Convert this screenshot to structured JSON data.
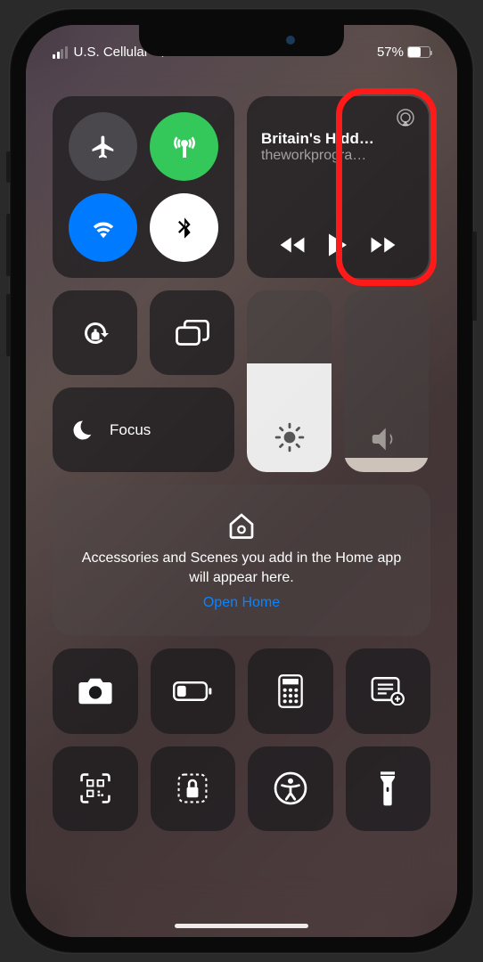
{
  "status": {
    "carrier": "U.S. Cellular",
    "battery_pct": "57%"
  },
  "media": {
    "title": "Britain's Hidd…",
    "subtitle": "theworkprogra…"
  },
  "focus": {
    "label": "Focus"
  },
  "brightness": {
    "level_pct": 60
  },
  "volume": {
    "level_pct": 8
  },
  "home": {
    "text": "Accessories and Scenes you add in the Home app will appear here.",
    "link": "Open Home"
  },
  "highlight": {
    "target": "volume-slider"
  }
}
